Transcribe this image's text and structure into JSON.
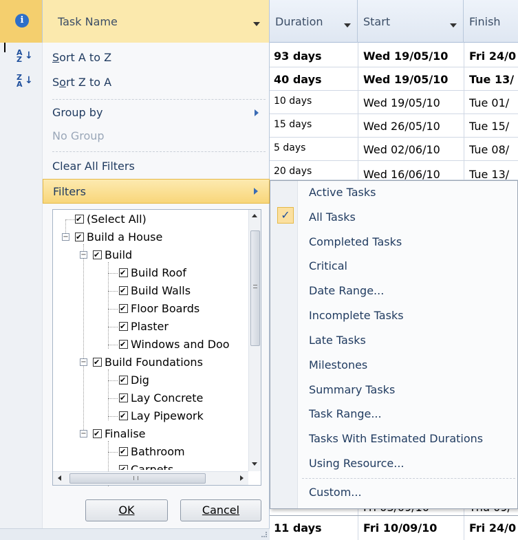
{
  "header": {
    "task_name": "Task Name",
    "duration": "Duration",
    "start": "Start",
    "finish": "Finish"
  },
  "grid": {
    "rows": [
      {
        "duration": "93 days",
        "start": "Wed 19/05/10",
        "finish": "Fri 24/0",
        "bold": true
      },
      {
        "duration": "40 days",
        "start": "Wed 19/05/10",
        "finish": "Tue 13/",
        "bold": true
      },
      {
        "duration": "10 days",
        "start": "Wed 19/05/10",
        "finish": "Tue 01/",
        "bold": false
      },
      {
        "duration": "15 days",
        "start": "Wed 26/05/10",
        "finish": "Tue 15/",
        "bold": false
      },
      {
        "duration": "5 days",
        "start": "Wed 02/06/10",
        "finish": "Tue 08/",
        "bold": false
      },
      {
        "duration": "20 days",
        "start": "Wed 16/06/10",
        "finish": "Tue 13/",
        "bold": false
      }
    ],
    "partial_start": "Fri 03/09/10",
    "partial_finish": "Thu 09/",
    "last_row": {
      "duration": "11 days",
      "start": "Fri 10/09/10",
      "finish": "Fri 24/0"
    }
  },
  "menu": {
    "sort_az_label_pre": "S",
    "sort_az_label_post": "ort A to Z",
    "sort_za_label_pre": "S",
    "sort_za_label_u": "o",
    "sort_za_label_post": "rt Z to A",
    "group_by": "Group by",
    "no_group": "No Group",
    "clear_filters": "Clear All Filters",
    "filters": "Filters"
  },
  "tree": {
    "select_all": "(Select All)",
    "build_a_house": "Build a House",
    "build": "Build",
    "build_roof": "Build Roof",
    "build_walls": "Build Walls",
    "floor_boards": "Floor Boards",
    "plaster": "Plaster",
    "windows": "Windows and Doo",
    "build_foundations": "Build Foundations",
    "dig": "Dig",
    "lay_concrete": "Lay Concrete",
    "lay_pipework": "Lay Pipework",
    "finalise": "Finalise",
    "bathroom": "Bathroom",
    "carpets": "Carpets"
  },
  "buttons": {
    "ok": "OK",
    "cancel": "Cancel"
  },
  "filters_submenu": {
    "items": [
      "Active Tasks",
      "All Tasks",
      "Completed Tasks",
      "Critical",
      "Date Range...",
      "Incomplete Tasks",
      "Late Tasks",
      "Milestones",
      "Summary Tasks",
      "Task Range...",
      "Tasks With Estimated Durations",
      "Using Resource..."
    ],
    "custom": "Custom...",
    "checked_item": "All Tasks"
  },
  "colors": {
    "highlight": "#f8d67a",
    "header_bg": "#dfe7f2",
    "info_icon": "#2d6fc8"
  }
}
